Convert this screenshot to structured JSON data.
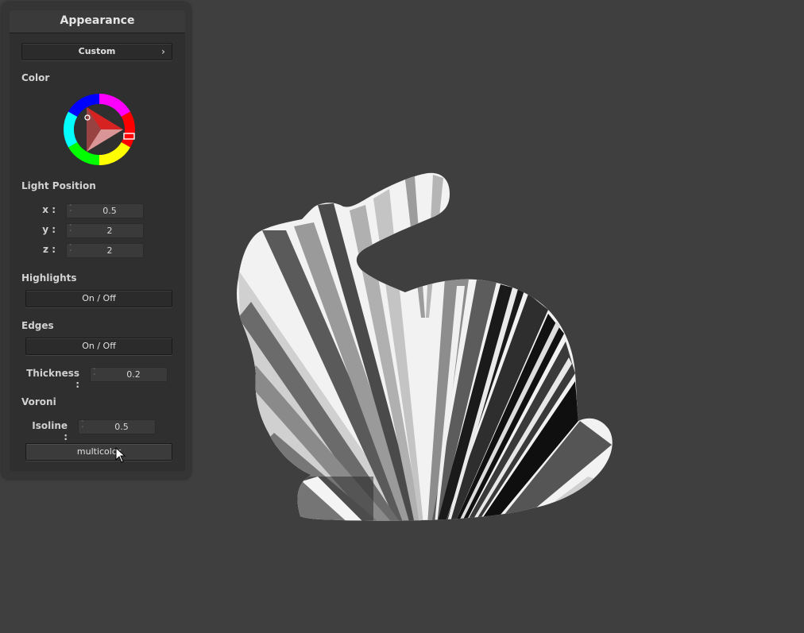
{
  "panel": {
    "title": "Appearance",
    "preset": {
      "label": "Custom",
      "chevron": "›"
    },
    "color": {
      "label": "Color",
      "selected_hue": "#ff0000"
    },
    "light_position": {
      "label": "Light Position",
      "x": {
        "label": "x :",
        "value": "0.5"
      },
      "y": {
        "label": "y :",
        "value": "2"
      },
      "z": {
        "label": "z :",
        "value": "2"
      }
    },
    "highlights": {
      "label": "Highlights",
      "button": "On / Off"
    },
    "edges": {
      "label": "Edges",
      "button": "On / Off",
      "thickness": {
        "label": "Thickness :",
        "value": "0.2"
      }
    },
    "voronoi": {
      "label": "Voroni",
      "isoline": {
        "label": "Isoline :",
        "value": "0.5"
      },
      "button": "multicolor"
    }
  },
  "colors": {
    "background": "#3f3f3f",
    "panel": "#2f2f2f"
  }
}
